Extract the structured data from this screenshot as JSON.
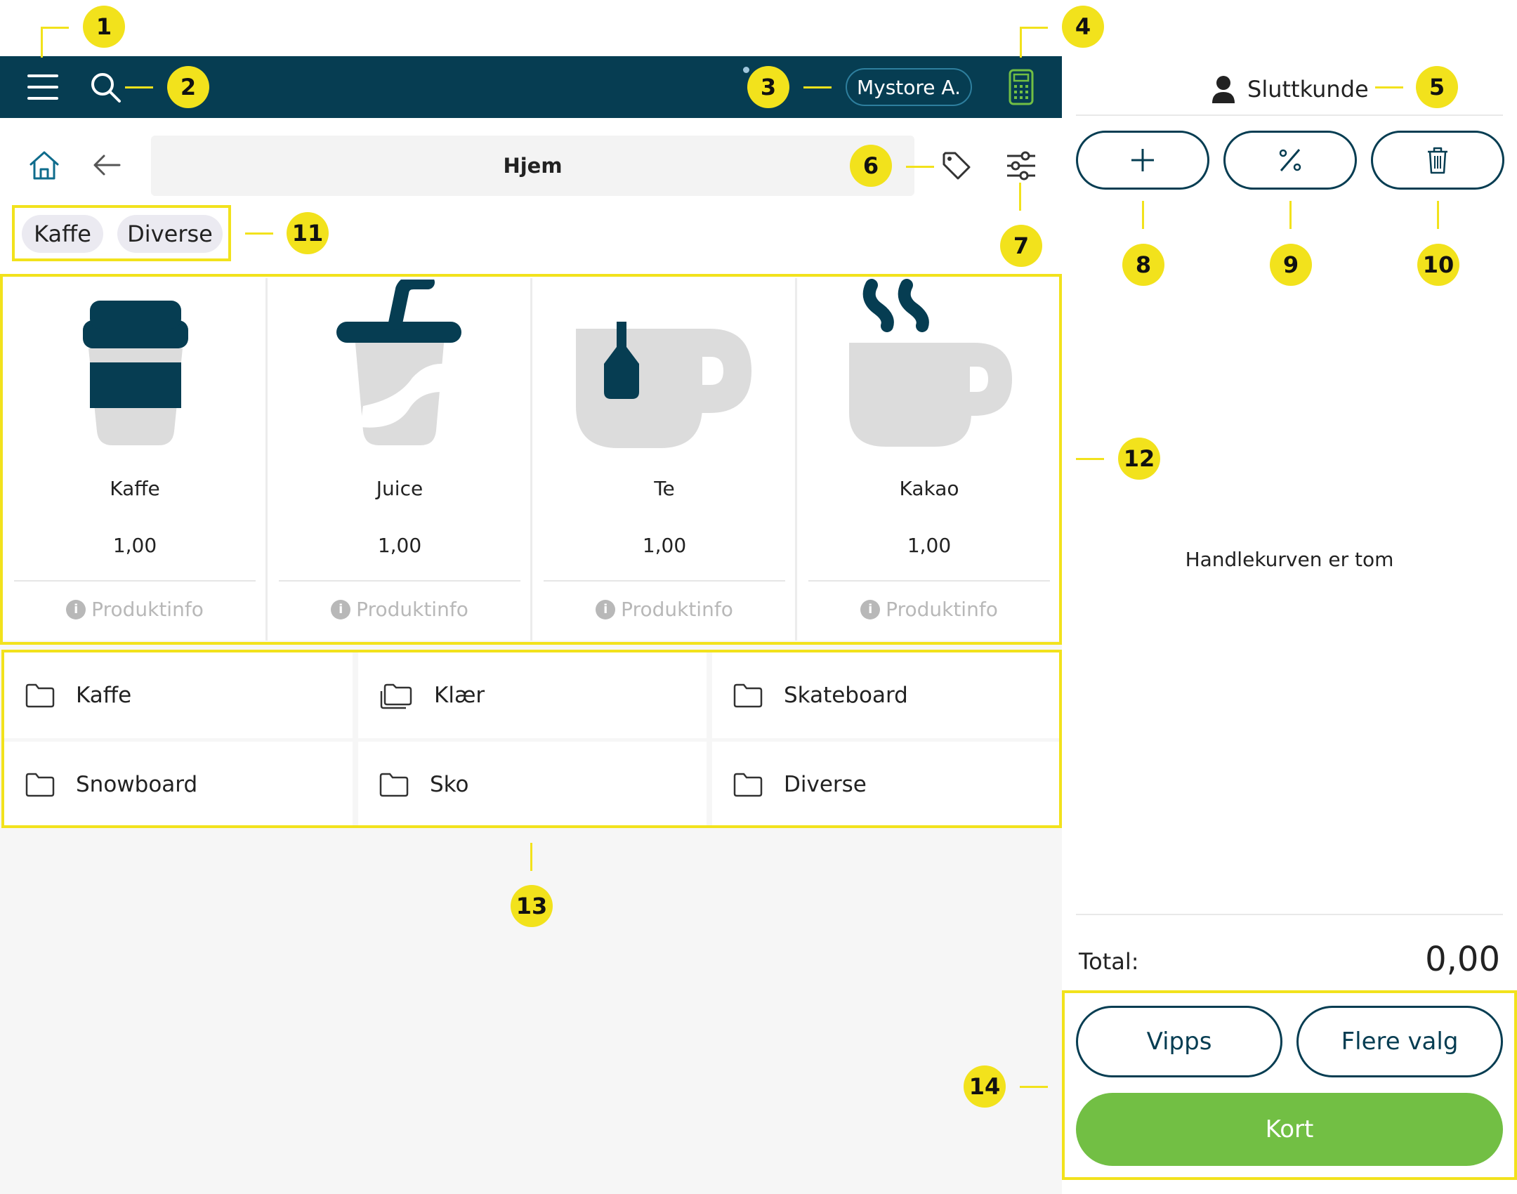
{
  "header": {
    "store_name": "Mystore A."
  },
  "nav": {
    "title": "Hjem"
  },
  "quick_chips": [
    "Kaffe",
    "Diverse"
  ],
  "products": [
    {
      "name": "Kaffe",
      "price": "1,00",
      "info_label": "Produktinfo",
      "icon": "coffee-cup-icon"
    },
    {
      "name": "Juice",
      "price": "1,00",
      "info_label": "Produktinfo",
      "icon": "juice-cup-icon"
    },
    {
      "name": "Te",
      "price": "1,00",
      "info_label": "Produktinfo",
      "icon": "tea-mug-icon"
    },
    {
      "name": "Kakao",
      "price": "1,00",
      "info_label": "Produktinfo",
      "icon": "cocoa-mug-icon"
    }
  ],
  "categories": [
    {
      "label": "Kaffe",
      "icon": "folder-icon"
    },
    {
      "label": "Klær",
      "icon": "folders-icon"
    },
    {
      "label": "Skateboard",
      "icon": "folder-icon"
    },
    {
      "label": "Snowboard",
      "icon": "folder-icon"
    },
    {
      "label": "Sko",
      "icon": "folder-icon"
    },
    {
      "label": "Diverse",
      "icon": "folder-icon"
    }
  ],
  "cart": {
    "customer_label": "Sluttkunde",
    "empty_text": "Handlekurven er tom",
    "total_label": "Total:",
    "total_value": "0,00"
  },
  "payment": {
    "vipps_label": "Vipps",
    "more_label": "Flere valg",
    "card_label": "Kort"
  },
  "callouts": [
    "1",
    "2",
    "3",
    "4",
    "5",
    "6",
    "7",
    "8",
    "9",
    "10",
    "11",
    "12",
    "13",
    "14"
  ],
  "colors": {
    "brand_dark": "#063d52",
    "accent_green": "#72bf44",
    "callout_yellow": "#f2e21c",
    "icon_light": "#dcdcdc"
  }
}
